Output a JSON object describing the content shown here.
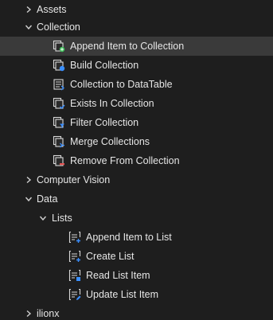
{
  "tree": {
    "assets": {
      "label": "Assets"
    },
    "collection": {
      "label": "Collection",
      "items": [
        {
          "label": "Append Item to Collection"
        },
        {
          "label": "Build Collection"
        },
        {
          "label": "Collection to DataTable"
        },
        {
          "label": "Exists In Collection"
        },
        {
          "label": "Filter Collection"
        },
        {
          "label": "Merge Collections"
        },
        {
          "label": "Remove From Collection"
        }
      ]
    },
    "computer_vision": {
      "label": "Computer Vision"
    },
    "data": {
      "label": "Data",
      "lists": {
        "label": "Lists",
        "items": [
          {
            "label": "Append Item to List"
          },
          {
            "label": "Create List"
          },
          {
            "label": "Read List Item"
          },
          {
            "label": "Update List Item"
          }
        ]
      }
    },
    "ilionx": {
      "label": "ilionx"
    }
  },
  "colors": {
    "background": "#1e1e1e",
    "selected": "#3a3a3a",
    "text": "#e6e6e6",
    "icon_badge_blue": "#3a8fff",
    "icon_badge_green": "#3fbf5a",
    "icon_badge_red": "#e05050"
  }
}
